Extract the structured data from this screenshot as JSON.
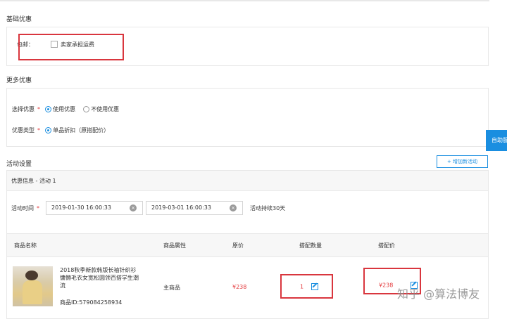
{
  "basic": {
    "title": "基础优惠",
    "free_shipping_label": "包邮：",
    "free_shipping_option": "卖家承担运费"
  },
  "more": {
    "title": "更多优惠",
    "select_label": "选择优惠",
    "use_discount": "使用优惠",
    "no_discount": "不使用优惠",
    "type_label": "优惠类型",
    "type_option": "单品折扣（原搭配价）"
  },
  "activity": {
    "title": "活动设置",
    "add_button": "+ 增加新活动",
    "info_title": "优惠信息 - 活动 1",
    "time_label": "活动时间",
    "start": "2019-01-30 16:00:33",
    "end": "2019-03-01 16:00:33",
    "duration": "活动持续30天"
  },
  "table": {
    "headers": [
      "商品名称",
      "商品属性",
      "原价",
      "搭配数量",
      "搭配价"
    ],
    "row": {
      "name": "2018秋季新款韩版长袖针织衫慵懒毛衣女宽松圆领百搭学生潮流",
      "id": "商品ID:579084258934",
      "attr": "主商品",
      "price": "¥238",
      "qty": "1",
      "combo_price": "¥238"
    }
  },
  "side_tab": "自助服",
  "watermark": "知乎 @算法博友",
  "colors": {
    "accent": "#1a8ee0",
    "red": "#e4393c",
    "highlight": "#d9363e"
  }
}
